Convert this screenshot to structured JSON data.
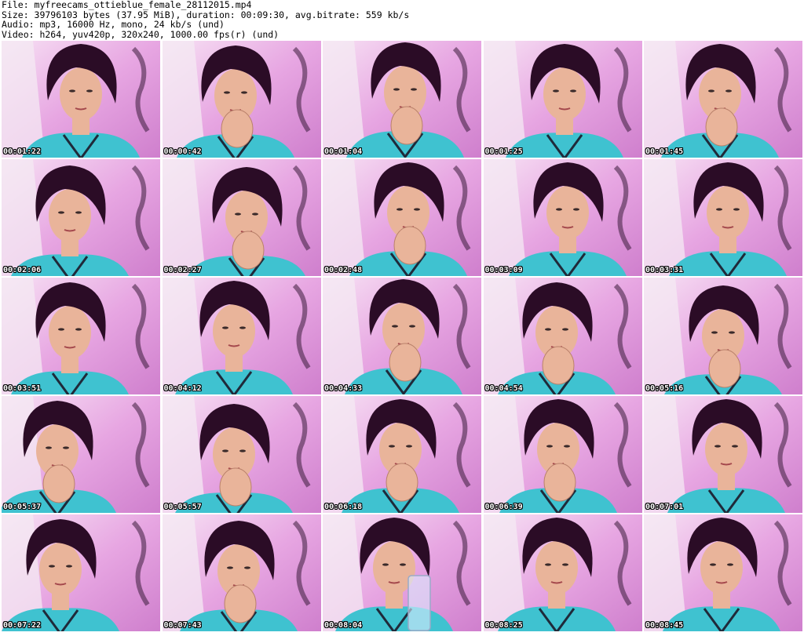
{
  "header": {
    "file_line": "File: myfreecams_ottieblue_female_28112015.mp4",
    "size_line": "Size: 39796103 bytes (37.95 MiB), duration: 00:09:30, avg.bitrate: 559 kb/s",
    "audio_line": "Audio: mp3, 16000 Hz, mono, 24 kb/s (und)",
    "video_line": "Video: h264, yuv420p, 320x240, 1000.00 fps(r) (und)"
  },
  "frames": [
    {
      "timestamp": "00:01:22"
    },
    {
      "timestamp": "00:00:42"
    },
    {
      "timestamp": "00:01:04"
    },
    {
      "timestamp": "00:01:25"
    },
    {
      "timestamp": "00:01:45"
    },
    {
      "timestamp": "00:02:06"
    },
    {
      "timestamp": "00:02:27"
    },
    {
      "timestamp": "00:02:48"
    },
    {
      "timestamp": "00:03:09"
    },
    {
      "timestamp": "00:03:31"
    },
    {
      "timestamp": "00:03:51"
    },
    {
      "timestamp": "00:04:12"
    },
    {
      "timestamp": "00:04:33"
    },
    {
      "timestamp": "00:04:54"
    },
    {
      "timestamp": "00:05:16"
    },
    {
      "timestamp": "00:05:37"
    },
    {
      "timestamp": "00:05:57"
    },
    {
      "timestamp": "00:06:18"
    },
    {
      "timestamp": "00:06:39"
    },
    {
      "timestamp": "00:07:01"
    },
    {
      "timestamp": "00:07:22"
    },
    {
      "timestamp": "00:07:43"
    },
    {
      "timestamp": "00:08:04"
    },
    {
      "timestamp": "00:08:25"
    },
    {
      "timestamp": "00:08:45"
    }
  ],
  "colors": {
    "background": "#ffffff",
    "wall_pink": "#e7a6e2",
    "hair": "#2b0c26",
    "skin": "#e9b49a",
    "shirt": "#3fc2d0",
    "timestamp_text": "#ffffff"
  }
}
